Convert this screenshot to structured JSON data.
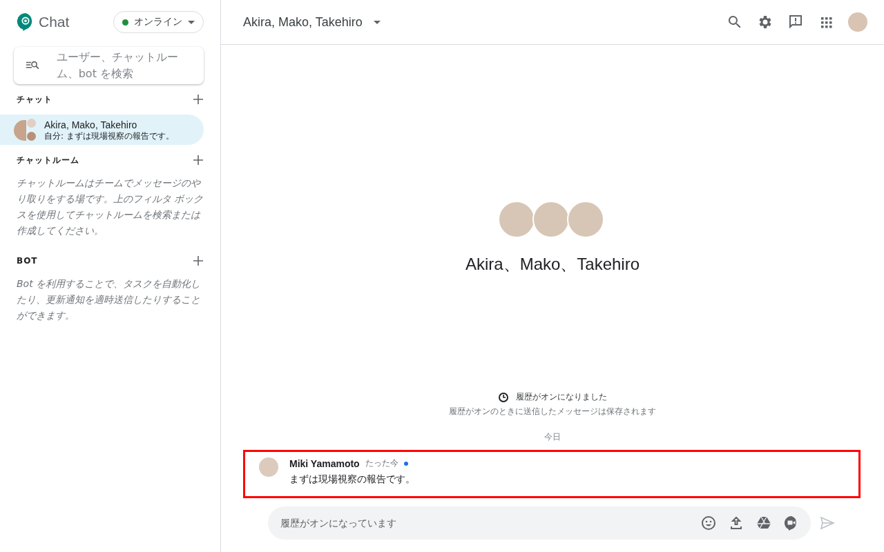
{
  "app": {
    "name": "Chat"
  },
  "status": {
    "label": "オンライン",
    "color": "#1e8e3e"
  },
  "search": {
    "placeholder": "ユーザー、チャットルーム、bot を検索"
  },
  "sections": [
    {
      "title": "チャット",
      "items": [
        {
          "name": "Akira, Mako, Takehiro",
          "snippet": "自分: まずは現場視察の報告です。",
          "selected": true
        }
      ]
    },
    {
      "title": "チャットルーム",
      "note": "チャットルームはチームでメッセージのやり取りをする場です。上のフィルタ ボックスを使用してチャットルームを検索または作成してください。"
    },
    {
      "title": "BOT",
      "note": "Bot を利用することで、タスクを自動化したり、更新通知を適時送信したりすることができます。"
    }
  ],
  "conversation": {
    "title": "Akira, Mako, Takehiro",
    "heading": "Akira、Mako、Takehiro",
    "history_title": "履歴がオンになりました",
    "history_note": "履歴がオンのときに送信したメッセージは保存されます",
    "date": "今日",
    "messages": [
      {
        "author": "Miki Yamamoto",
        "time": "たった今",
        "unread": true,
        "text": "まずは現場視察の報告です。",
        "highlighted": true
      }
    ],
    "composer": {
      "placeholder": "履歴がオンになっています"
    }
  }
}
